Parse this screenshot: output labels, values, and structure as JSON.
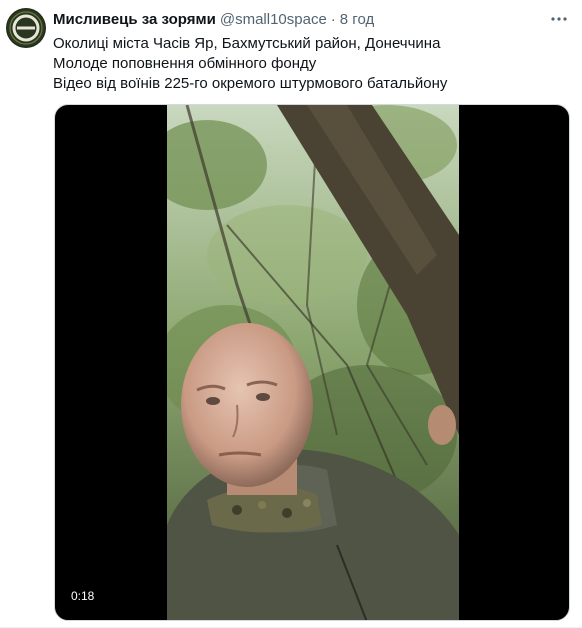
{
  "author": {
    "display_name": "Мисливець за зорями",
    "handle": "@small10space",
    "separator": "·",
    "time": "8 год"
  },
  "icons": {
    "more": "more-horizontal-icon",
    "avatar": "avatar-logo"
  },
  "tweet": {
    "lines": [
      "Околиці міста Часів Яр, Бахмутський район, Донеччина",
      "Молоде поповнення обмінного фонду",
      "Відео від воїнів 225-го окремого штурмового батальйону"
    ]
  },
  "video": {
    "duration": "0:18"
  },
  "colors": {
    "text_primary": "#0f1419",
    "text_secondary": "#536471",
    "media_background": "#000000"
  }
}
